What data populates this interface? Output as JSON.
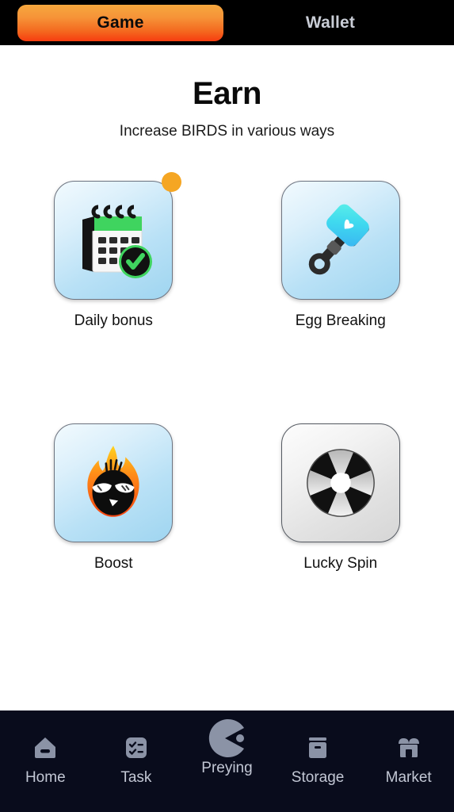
{
  "topbar": {
    "tabs": [
      {
        "label": "Game",
        "active": true
      },
      {
        "label": "Wallet",
        "active": false
      }
    ],
    "active_gradient_from": "#f6a83e",
    "active_gradient_to": "#f63c10",
    "background": "#000000"
  },
  "header": {
    "title": "Earn",
    "subtitle": "Increase BIRDS in various ways"
  },
  "earn_items": [
    {
      "label": "Daily bonus",
      "icon": "calendar-check-icon",
      "state": "active",
      "badge": true,
      "badge_color": "#f5a623"
    },
    {
      "label": "Egg Breaking",
      "icon": "hammer-icon",
      "state": "active",
      "badge": false
    },
    {
      "label": "Boost",
      "icon": "flame-bird-icon",
      "state": "active",
      "badge": false
    },
    {
      "label": "Lucky Spin",
      "icon": "spin-wheel-icon",
      "state": "disabled",
      "badge": false
    }
  ],
  "bottom_nav": {
    "background": "#090c1c",
    "item_color": "#8b93a6",
    "label_color": "#c2c7d4",
    "items": [
      {
        "label": "Home",
        "icon": "home-icon"
      },
      {
        "label": "Task",
        "icon": "checklist-icon"
      },
      {
        "label": "Preying",
        "icon": "pacman-icon"
      },
      {
        "label": "Storage",
        "icon": "box-icon"
      },
      {
        "label": "Market",
        "icon": "shop-icon"
      }
    ]
  }
}
